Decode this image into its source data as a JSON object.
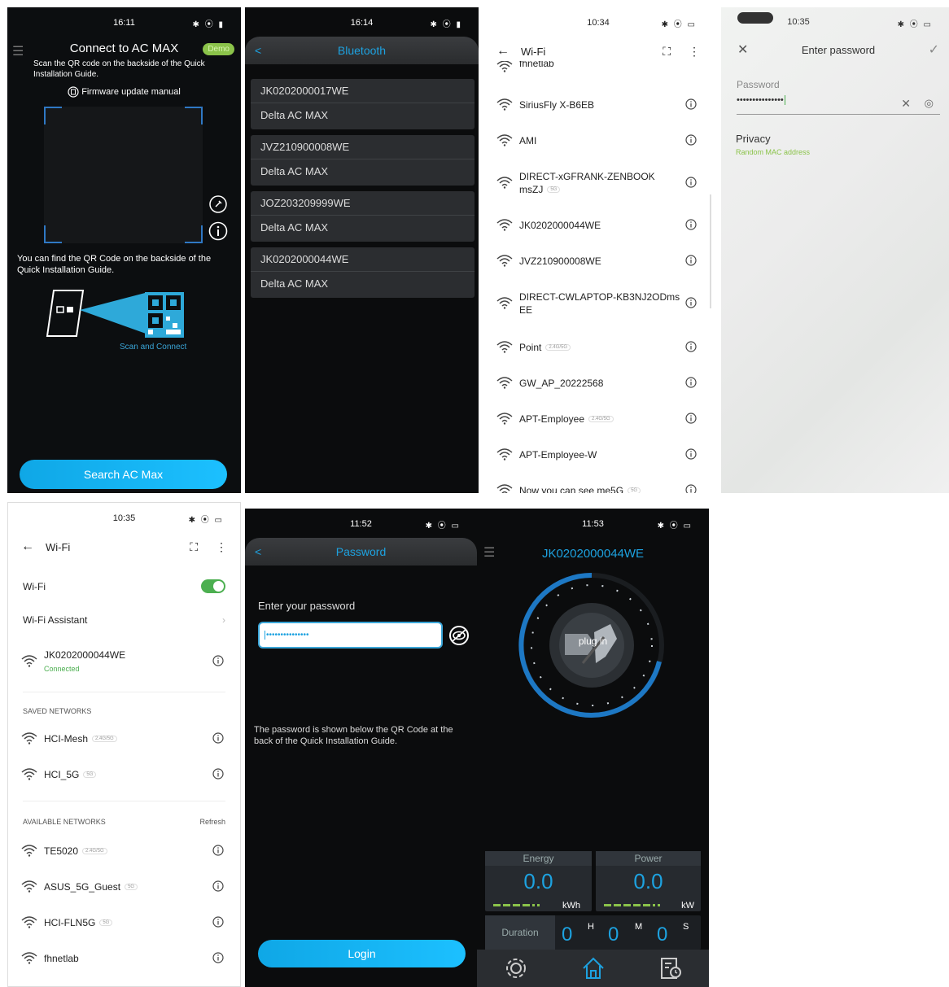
{
  "p1": {
    "status_time": "16:11",
    "title": "Connect to AC MAX",
    "demo": "Demo",
    "subtitle": "Scan the QR code on the backside of the Quick Installation Guide.",
    "fw_label": "Firmware update manual",
    "find_text": "You can find the QR Code on the backside of the Quick Installation Guide.",
    "scan_label": "Scan and Connect",
    "search_btn": "Search AC Max"
  },
  "p2": {
    "status_time": "16:14",
    "title": "Bluetooth",
    "devices": [
      {
        "serial": "JK0202000017WE",
        "model": "Delta AC MAX"
      },
      {
        "serial": "JVZ210900008WE",
        "model": "Delta AC MAX"
      },
      {
        "serial": "JOZ203209999WE",
        "model": "Delta AC MAX"
      },
      {
        "serial": "JK0202000044WE",
        "model": "Delta AC MAX"
      }
    ]
  },
  "p3": {
    "status_time": "10:34",
    "title": "Wi-Fi",
    "top_cut": "fhnetlab",
    "networks": [
      {
        "name": "SiriusFly X-B6EB",
        "tag": ""
      },
      {
        "name": "AMI",
        "tag": ""
      },
      {
        "name": "DIRECT-xGFRANK-ZENBOOK msZJ",
        "tag": "5G"
      },
      {
        "name": "JK0202000044WE",
        "tag": ""
      },
      {
        "name": "JVZ210900008WE",
        "tag": ""
      },
      {
        "name": "DIRECT-CWLAPTOP-KB3NJ2ODms EE",
        "tag": ""
      },
      {
        "name": "Point",
        "tag": "2.4G/5G"
      },
      {
        "name": "GW_AP_20222568",
        "tag": ""
      },
      {
        "name": "APT-Employee",
        "tag": "2.4G/5G"
      },
      {
        "name": "APT-Employee-W",
        "tag": ""
      },
      {
        "name": "Now you can see me5G",
        "tag": "5G"
      }
    ]
  },
  "p4": {
    "status_time": "10:35",
    "title": "Enter password",
    "pw_label": "Password",
    "pw_value": "•••••••••••••••",
    "privacy": "Privacy",
    "privacy_sub": "Random MAC address"
  },
  "p5": {
    "status_time": "10:35",
    "title": "Wi-Fi",
    "wifi_label": "Wi-Fi",
    "assistant": "Wi-Fi Assistant",
    "connected_name": "JK0202000044WE",
    "connected_status": "Connected",
    "saved_header": "SAVED NETWORKS",
    "saved": [
      {
        "name": "HCI-Mesh",
        "tag": "2.4G/5G"
      },
      {
        "name": "HCI_5G",
        "tag": "5G"
      }
    ],
    "avail_header": "AVAILABLE NETWORKS",
    "refresh": "Refresh",
    "available": [
      {
        "name": "TE5020",
        "tag": "2.4G/5G"
      },
      {
        "name": "ASUS_5G_Guest",
        "tag": "5G"
      },
      {
        "name": "HCI-FLN5G",
        "tag": "5G"
      },
      {
        "name": "fhnetlab",
        "tag": ""
      }
    ]
  },
  "p6": {
    "status_time": "11:52",
    "title": "Password",
    "prompt": "Enter your password",
    "pw_value": "•••••••••••••••",
    "note": "The password is shown below the QR Code at the back of the Quick Installation Guide.",
    "login": "Login"
  },
  "p7": {
    "status_time": "11:53",
    "device": "JK0202000044WE",
    "plug": "plug in",
    "energy_label": "Energy",
    "energy_value": "0.0",
    "energy_unit": "kWh",
    "power_label": "Power",
    "power_value": "0.0",
    "power_unit": "kW",
    "duration_label": "Duration",
    "h_val": "0",
    "h": "H",
    "m_val": "0",
    "m": "M",
    "s_val": "0",
    "s": "S"
  },
  "colors": {
    "accent": "#1da2e0",
    "green": "#8bc34a",
    "toggle": "#4caf50"
  }
}
